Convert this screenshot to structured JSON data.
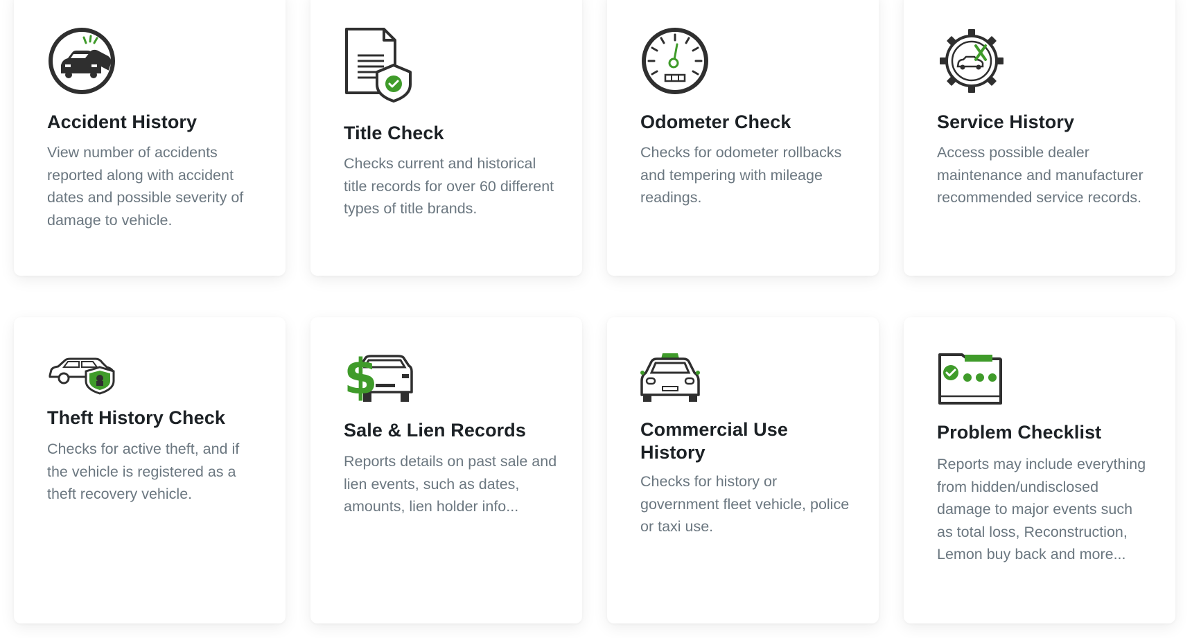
{
  "cards": [
    {
      "title": "Accident History",
      "description": "View number of accidents reported along with accident dates and possible severity of damage to vehicle.",
      "icon": "car-accident-icon"
    },
    {
      "title": "Title Check",
      "description": "Checks current and historical title records for over 60 different types of title brands.",
      "icon": "title-document-shield-icon"
    },
    {
      "title": "Odometer Check",
      "description": "Checks for odometer rollbacks and tempering with mileage readings.",
      "icon": "odometer-gauge-icon"
    },
    {
      "title": "Service History",
      "description": "Access possible dealer maintenance and manufacturer recommended service records.",
      "icon": "gear-car-service-icon"
    },
    {
      "title": "Theft History Check",
      "description": "Checks for active theft, and if the vehicle is registered as a theft recovery vehicle.",
      "icon": "car-theft-shield-icon"
    },
    {
      "title": "Sale & Lien Records",
      "description": "Reports details on past sale and lien events, such as dates, amounts, lien holder info...",
      "icon": "dollar-car-icon"
    },
    {
      "title": "Commercial Use History",
      "description": "Checks for history or government fleet vehicle, police or taxi use.",
      "icon": "taxi-icon"
    },
    {
      "title": "Problem Checklist",
      "description": "Reports may include everything from hidden/undisclosed damage to major events such as total loss, Reconstruction, Lemon buy back and more...",
      "icon": "folder-checklist-icon"
    }
  ],
  "colors": {
    "accent_green": "#3f9b2a",
    "icon_dark": "#2f2f2f",
    "title": "#1c2125",
    "text": "#6b7780"
  }
}
